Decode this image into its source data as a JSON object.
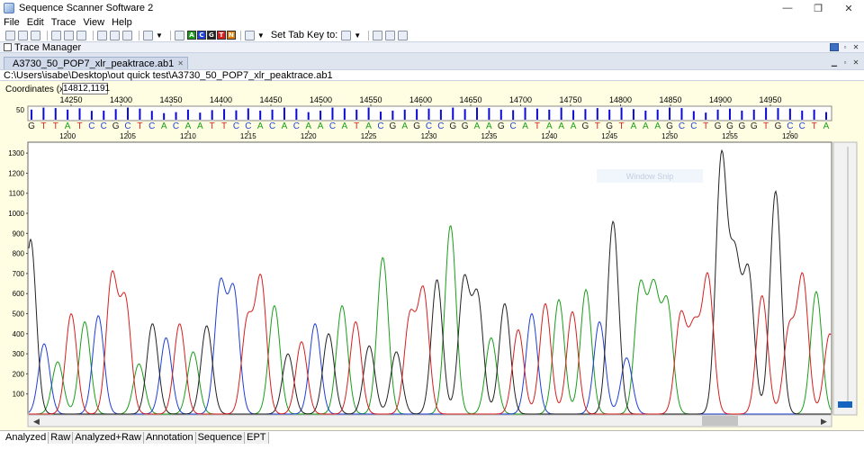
{
  "window": {
    "title": "Sequence Scanner Software 2",
    "minimize_glyph": "—",
    "maximize_glyph": "❐",
    "close_glyph": "✕"
  },
  "menu": {
    "items": [
      "File",
      "Edit",
      "Trace",
      "View",
      "Help"
    ]
  },
  "toolbar": {
    "set_tab_key_label": "Set Tab Key to:",
    "base_buttons": [
      {
        "label": "A",
        "color": "#1a9e1a"
      },
      {
        "label": "C",
        "color": "#1f3fd6"
      },
      {
        "label": "G",
        "color": "#222222"
      },
      {
        "label": "T",
        "color": "#d61f1f"
      },
      {
        "label": "N",
        "color": "#e07a00"
      }
    ]
  },
  "trace_manager": {
    "label": "Trace Manager"
  },
  "document": {
    "tab_label": "A3730_50_POP7_xlr_peaktrace.ab1",
    "path": "C:\\Users\\isabe\\Desktop\\out quick test\\A3730_50_POP7_xlr_peaktrace.ab1"
  },
  "coordinates": {
    "label": "Coordinates (x,y):",
    "value": "14812,1191"
  },
  "overlay": {
    "label": "Window Snip"
  },
  "quality_axis": {
    "max_label": "50"
  },
  "scan_axis": {
    "ticks": [
      14250,
      14300,
      14350,
      14400,
      14450,
      14500,
      14550,
      14600,
      14650,
      14700,
      14750,
      14800,
      14850,
      14900,
      14950
    ]
  },
  "sequence": {
    "bases": "GTTATCCGCTCACAATTCCACACAACATACGAGCCGGAAGCATAAAGTGTAAAGCCTGGGGTGCCTA",
    "qualities": [
      40,
      48,
      46,
      40,
      45,
      35,
      36,
      42,
      48,
      44,
      35,
      26,
      30,
      40,
      28,
      38,
      42,
      37,
      45,
      36,
      40,
      48,
      44,
      30,
      36,
      48,
      45,
      40,
      48,
      32,
      36,
      40,
      42,
      44,
      40,
      48,
      42,
      48,
      46,
      40,
      38,
      48,
      44,
      40,
      48,
      38,
      42,
      46,
      40,
      48,
      42,
      36,
      40,
      48,
      46,
      34,
      28,
      40,
      44,
      36,
      40,
      48,
      46,
      44,
      36,
      40
    ],
    "base_colors": {
      "A": "#1a9e1a",
      "C": "#1f3fd6",
      "G": "#222222",
      "T": "#d61f1f"
    },
    "quality_bar_color": "#0a0ad6",
    "position_ticks": [
      1200,
      1205,
      1210,
      1215,
      1220,
      1225,
      1230,
      1235,
      1240,
      1245,
      1250,
      1255,
      1260
    ],
    "first_position": 1197
  },
  "chart_data": {
    "type": "line",
    "ylim": [
      0,
      1350
    ],
    "yticks": [
      100,
      200,
      300,
      400,
      500,
      600,
      700,
      800,
      900,
      1000,
      1100,
      1200,
      1300
    ],
    "peak_heights": [
      870,
      350,
      260,
      500,
      460,
      490,
      680,
      560,
      250,
      450,
      380,
      450,
      310,
      440,
      640,
      610,
      460,
      670,
      540,
      300,
      360,
      450,
      400,
      540,
      460,
      340,
      780,
      310,
      480,
      610,
      670,
      940,
      660,
      580,
      380,
      550,
      420,
      500,
      550,
      570,
      510,
      620,
      460,
      960,
      280,
      630,
      610,
      550,
      490,
      420,
      680,
      1270,
      750,
      700,
      590,
      1110,
      420,
      680,
      610,
      400
    ],
    "series": [
      {
        "name": "A",
        "color": "#1a9e1a"
      },
      {
        "name": "C",
        "color": "#1f3fd6"
      },
      {
        "name": "G",
        "color": "#222222"
      },
      {
        "name": "T",
        "color": "#d61f1f"
      }
    ]
  },
  "bottom_tabs": [
    "Analyzed",
    "Raw",
    "Analyzed+Raw",
    "Annotation",
    "Sequence",
    "EPT"
  ]
}
